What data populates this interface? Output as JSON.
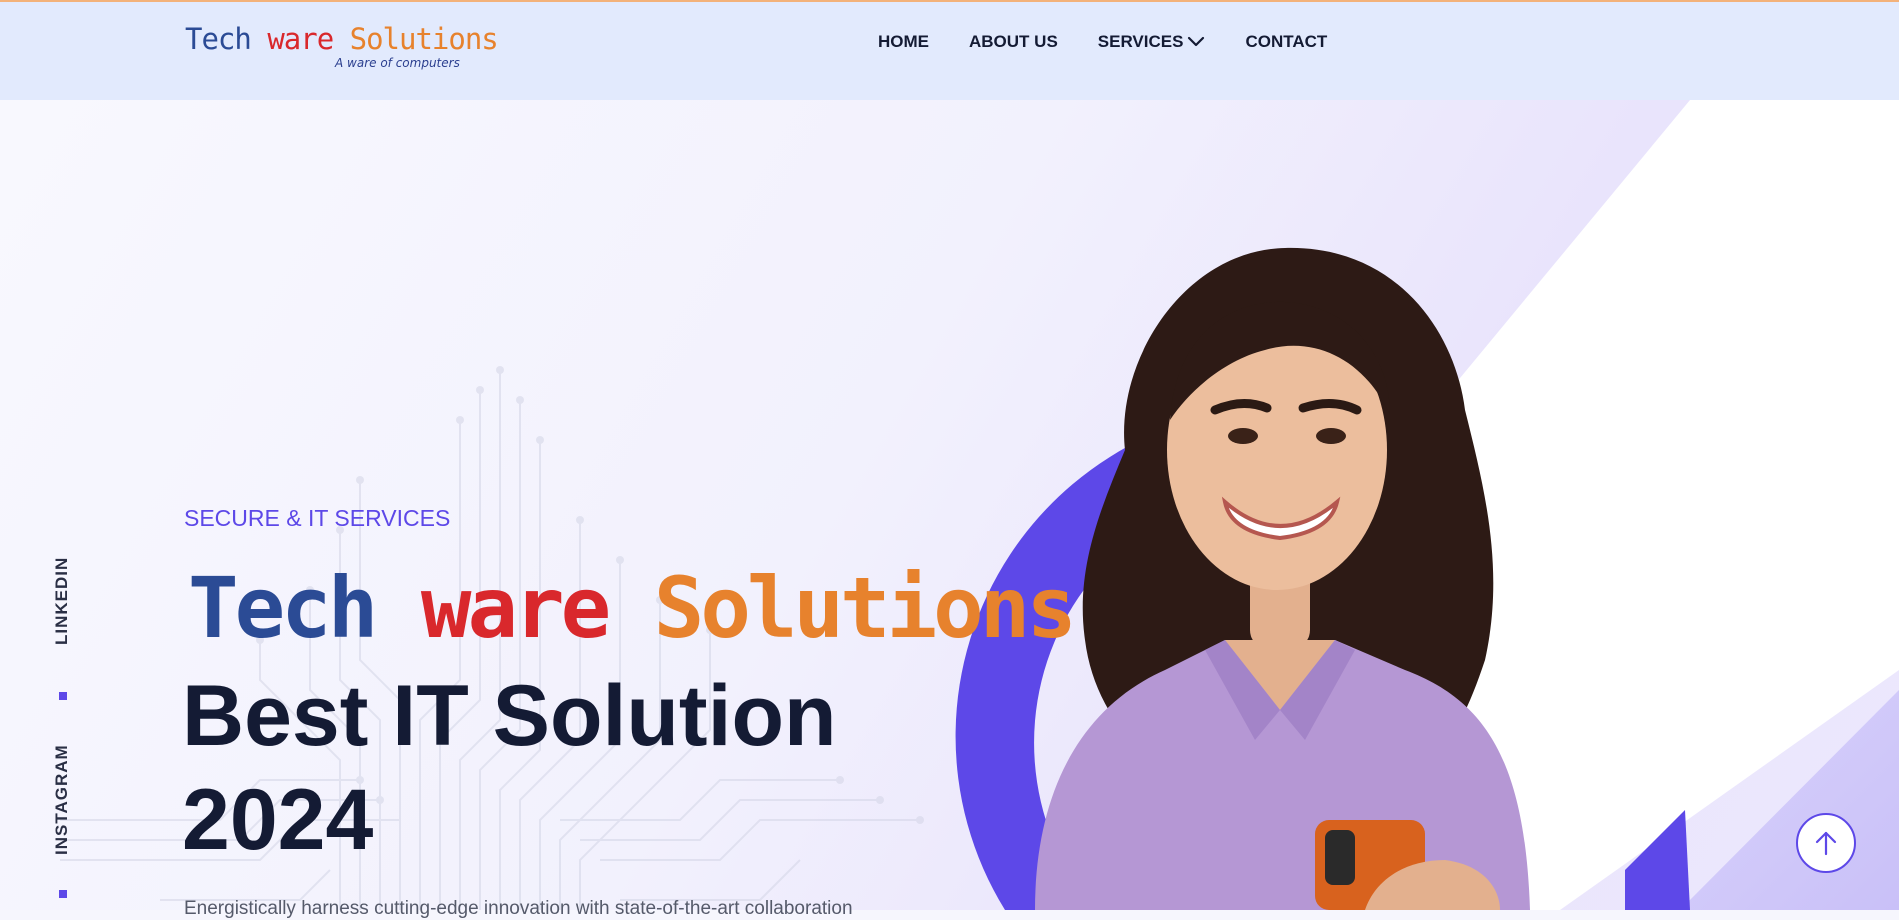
{
  "header": {
    "logo": {
      "part1": "Tech",
      "part2": "ware",
      "part3": "Solutions",
      "tagline": "A ware of computers"
    },
    "nav": [
      {
        "label": "HOME"
      },
      {
        "label": "ABOUT US"
      },
      {
        "label": "SERVICES",
        "has_dropdown": true,
        "icon": "chevron-down-icon"
      },
      {
        "label": "CONTACT"
      }
    ]
  },
  "hero": {
    "kicker": "SECURE & IT SERVICES",
    "brand": {
      "part1": "Tech",
      "part2": "ware",
      "part3": "Solutions"
    },
    "headline_line1": "Best IT Solution",
    "headline_line2": "2024",
    "paragraph": "Energistically harness cutting-edge innovation with state-of-the-art collaboration"
  },
  "social": [
    {
      "label": "LINKEDIN"
    },
    {
      "label": "INSTAGRAM"
    }
  ],
  "scroll_top": {
    "icon": "arrow-up-icon"
  },
  "colors": {
    "accent": "#5d48e8",
    "brand_blue": "#2b4b95",
    "brand_red": "#d9282c",
    "brand_orange": "#e7822d",
    "header_bg": "#e2eafd",
    "heading": "#141b34"
  }
}
